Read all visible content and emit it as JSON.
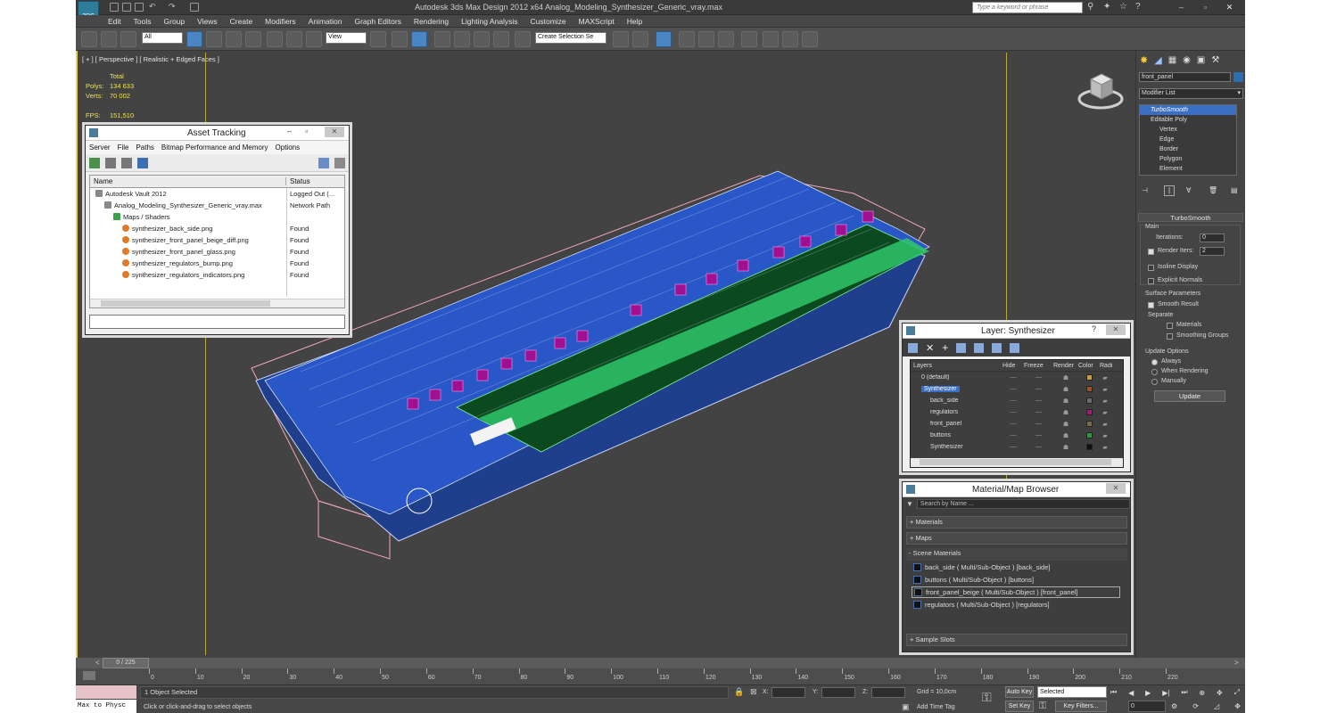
{
  "window": {
    "title": "Autodesk 3ds Max Design 2012 x64      Analog_Modeling_Synthesizer_Generic_vray.max",
    "search_placeholder": "Type a keyword or phrase"
  },
  "menu": [
    "Edit",
    "Tools",
    "Group",
    "Views",
    "Create",
    "Modifiers",
    "Animation",
    "Graph Editors",
    "Rendering",
    "Lighting Analysis",
    "Customize",
    "MAXScript",
    "Help"
  ],
  "toolbar": {
    "filter_value": "All",
    "refcoord_value": "View",
    "selection_set_value": "Create Selection Se"
  },
  "viewport": {
    "label": "[ + ] [ Perspective ] [ Realistic + Edged Faces ]",
    "stats": {
      "total_label": "Total",
      "polys_label": "Polys:",
      "polys_value": "134 633",
      "verts_label": "Verts:",
      "verts_value": "70 002",
      "fps_label": "FPS:",
      "fps_value": "151,510"
    }
  },
  "asset_tracking": {
    "title": "Asset Tracking",
    "menu": [
      "Server",
      "File",
      "Paths",
      "Bitmap Performance and Memory",
      "Options"
    ],
    "columns": [
      "Name",
      "Status"
    ],
    "rows": [
      {
        "name": "Autodesk Vault 2012",
        "status": "Logged Out (...",
        "indent": 0
      },
      {
        "name": "Analog_Modeling_Synthesizer_Generic_vray.max",
        "status": "Network Path",
        "indent": 1
      },
      {
        "name": "Maps / Shaders",
        "status": "",
        "indent": 2
      },
      {
        "name": "synthesizer_back_side.png",
        "status": "Found",
        "indent": 3
      },
      {
        "name": "synthesizer_front_panel_beige_diff.png",
        "status": "Found",
        "indent": 3
      },
      {
        "name": "synthesizer_front_panel_glass.png",
        "status": "Found",
        "indent": 3
      },
      {
        "name": "synthesizer_regulators_bump.png",
        "status": "Found",
        "indent": 3
      },
      {
        "name": "synthesizer_regulators_indicators.png",
        "status": "Found",
        "indent": 3
      }
    ]
  },
  "layer_panel": {
    "title": "Layer: Synthesizer",
    "help": "?",
    "columns": [
      "Layers",
      "Hide",
      "Freeze",
      "Render",
      "Color",
      "Radio"
    ],
    "rows": [
      {
        "name": "0 (default)",
        "color": "#c8a02a",
        "indent": 0,
        "selected": false
      },
      {
        "name": "Synthesizer",
        "color": "#a0521a",
        "indent": 0,
        "selected": true
      },
      {
        "name": "back_side",
        "color": "#6b6b6b",
        "indent": 1,
        "selected": false
      },
      {
        "name": "regulators",
        "color": "#b0127a",
        "indent": 1,
        "selected": false
      },
      {
        "name": "front_panel",
        "color": "#7a6a4a",
        "indent": 1,
        "selected": false
      },
      {
        "name": "buttons",
        "color": "#1fa03a",
        "indent": 1,
        "selected": false
      },
      {
        "name": "Synthesizer",
        "color": "#111111",
        "indent": 1,
        "selected": false
      }
    ]
  },
  "material_browser": {
    "title": "Material/Map Browser",
    "search_placeholder": "Search by Name ...",
    "groups": [
      "+ Materials",
      "+ Maps",
      "- Scene Materials"
    ],
    "scene_materials": [
      "back_side  ( Multi/Sub-Object ) [back_side]",
      "buttons  ( Multi/Sub-Object ) [buttons]",
      "front_panel_beige  ( Multi/Sub-Object ) [front_panel]",
      "regulators  ( Multi/Sub-Object ) [regulators]"
    ],
    "sample_slots": "+ Sample Slots"
  },
  "command_panel": {
    "object_name": "front_panel",
    "modifier_list": "Modifier List",
    "stack": [
      {
        "label": "TurboSmooth",
        "level": 0,
        "selected": true
      },
      {
        "label": "Editable Poly",
        "level": 0,
        "selected": false
      },
      {
        "label": "Vertex",
        "level": 1,
        "selected": false
      },
      {
        "label": "Edge",
        "level": 1,
        "selected": false
      },
      {
        "label": "Border",
        "level": 1,
        "selected": false
      },
      {
        "label": "Polygon",
        "level": 1,
        "selected": false
      },
      {
        "label": "Element",
        "level": 1,
        "selected": false
      }
    ],
    "turbosmooth": {
      "header": "TurboSmooth",
      "main": "Main",
      "iterations_label": "Iterations:",
      "iterations_value": "0",
      "render_iters_label": "Render Iters:",
      "render_iters_value": "2",
      "isoline": "Isoline Display",
      "explicit": "Explicit Normals",
      "surface_params": "Surface Parameters",
      "smooth_result": "Smooth Result",
      "separate": "Separate",
      "materials": "Materials",
      "smoothing_groups": "Smoothing Groups",
      "update_options": "Update Options",
      "always": "Always",
      "when_rendering": "When Rendering",
      "manually": "Manually",
      "update_btn": "Update"
    }
  },
  "timeline": {
    "frame": "0 / 225",
    "ticks": [
      "0",
      "10",
      "20",
      "30",
      "40",
      "50",
      "60",
      "70",
      "80",
      "90",
      "100",
      "110",
      "120",
      "130",
      "140",
      "150",
      "160",
      "170",
      "180",
      "190",
      "200",
      "210",
      "220"
    ]
  },
  "status": {
    "script_listener": "Max to Physc",
    "selected": "1 Object Selected",
    "prompt": "Click or click-and-drag to select objects",
    "x_label": "X:",
    "y_label": "Y:",
    "z_label": "Z:",
    "grid": "Grid = 10,0cm",
    "add_time_tag": "Add Time Tag",
    "auto_key": "Auto Key",
    "selected_value": "Selected",
    "set_key": "Set Key",
    "key_filters": "Key Filters...",
    "frame_value": "0"
  }
}
